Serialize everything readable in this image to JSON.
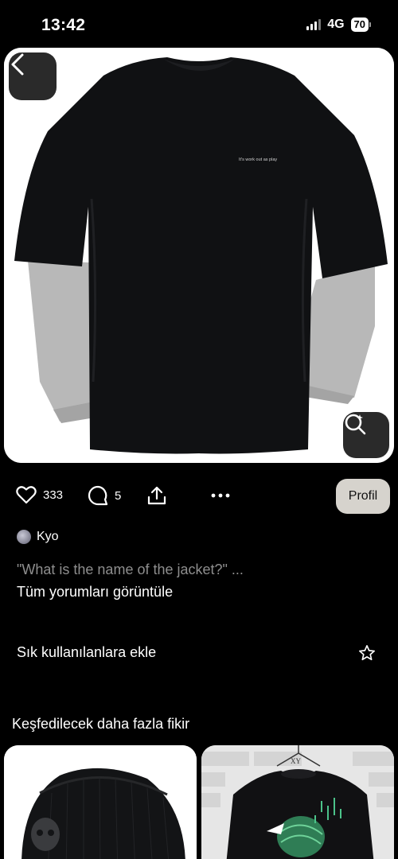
{
  "status_bar": {
    "time": "13:42",
    "network": "4G",
    "battery": "70"
  },
  "pin": {
    "print_text": "It's work out as play",
    "likes": "333",
    "comments": "5",
    "profile_button": "Profil"
  },
  "comment": {
    "author": "Kyo",
    "text": "\"What is the name of the jacket?\" ...",
    "view_all": "Tüm yorumları görüntüle"
  },
  "favorites": {
    "label": "Sık kullanılanlara ekle"
  },
  "explore": {
    "title": "Keşfedilecek daha fazla fikir",
    "thumb2_label": "XY"
  },
  "icons": [
    "back-icon",
    "visual-search-icon",
    "heart-icon",
    "comment-icon",
    "share-icon",
    "more-icon",
    "star-icon"
  ],
  "colors": {
    "background": "#000000",
    "button_bg": "#2a2a2a",
    "profil_bg": "#d6d3cd",
    "muted_text": "#8e8e8e"
  }
}
